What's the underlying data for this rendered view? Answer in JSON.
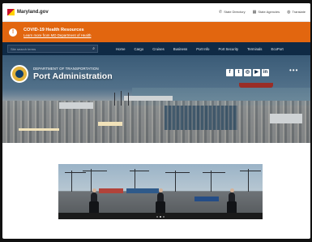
{
  "topbar": {
    "site": "Maryland.gov",
    "links": [
      {
        "icon": "phone-icon",
        "label": "State Directory"
      },
      {
        "icon": "building-icon",
        "label": "State Agencies"
      },
      {
        "icon": "globe-icon",
        "label": "Translate"
      }
    ]
  },
  "alert": {
    "title": "COVID-19 Health Resources",
    "link": "Learn more from MD Department of Health"
  },
  "nav": {
    "search_placeholder": "Site search terms",
    "items": [
      "Home",
      "Cargo",
      "Cruises",
      "Business",
      "Port Info",
      "Port Security",
      "Terminals",
      "EcoPort"
    ]
  },
  "hero": {
    "brand_subtitle": "DEPARTMENT OF TRANSPORTATION",
    "brand_title": "Port Administration",
    "social": [
      "facebook-icon",
      "twitter-icon",
      "instagram-icon",
      "youtube-icon",
      "linkedin-icon"
    ],
    "more": "•••"
  },
  "carousel": {
    "slides": 3,
    "active_index": 1
  }
}
